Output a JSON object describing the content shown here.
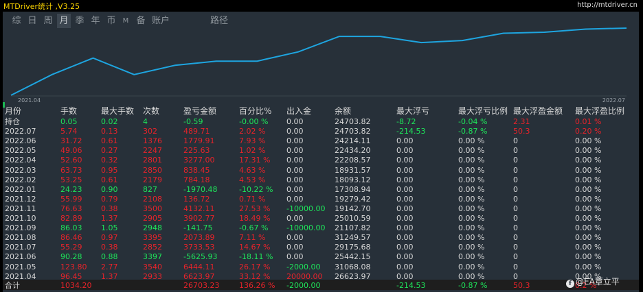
{
  "app": {
    "title": "MTDriver统计 ,V3.25",
    "url": "http://mtdriver.cn"
  },
  "tabs": [
    {
      "label": "综",
      "active": false
    },
    {
      "label": "日",
      "active": false
    },
    {
      "label": "周",
      "active": false
    },
    {
      "label": "月",
      "active": true
    },
    {
      "label": "季",
      "active": false
    },
    {
      "label": "年",
      "active": false
    },
    {
      "label": "币",
      "active": false
    },
    {
      "label": "M",
      "active": false
    },
    {
      "label": "备",
      "active": false
    },
    {
      "label": "账户",
      "active": false
    },
    {
      "label": "路径",
      "active": false
    }
  ],
  "chart_data": {
    "type": "line",
    "x_start_label": "2021.04",
    "x_end_label": "2022.07",
    "x": [
      "2021.04",
      "2021.05",
      "2021.06",
      "2021.07",
      "2021.08",
      "2021.09",
      "2021.10",
      "2021.11",
      "2021.12",
      "2022.01",
      "2022.02",
      "2022.03",
      "2022.04",
      "2022.05",
      "2022.06",
      "2022.07"
    ],
    "y": [
      19000,
      21000,
      22600,
      21000,
      21900,
      22300,
      22300,
      23200,
      24700,
      24700,
      24100,
      24300,
      25000,
      25100,
      25400,
      25500
    ],
    "line_color": "#1ea5e0"
  },
  "table": {
    "columns": [
      "月份",
      "手数",
      "最大手数",
      "次数",
      "盈亏金额",
      "百分比%",
      "出入金",
      "余额",
      "最大浮亏",
      "最大浮亏比例",
      "最大浮盈金额",
      "最大浮盈比例"
    ],
    "rows": [
      {
        "c": [
          "持仓",
          "0.05",
          "0.02",
          "4",
          "-0.59",
          "-0.00 %",
          "0.00",
          "24703.82",
          "-8.72",
          "-0.04 %",
          "2.31",
          "0.01 %"
        ],
        "k": "g"
      },
      {
        "c": [
          "2022.07",
          "5.74",
          "0.13",
          "302",
          "489.71",
          "2.02 %",
          "0.00",
          "24703.82",
          "-214.53",
          "-0.87 %",
          "50.3",
          "0.20 %"
        ],
        "k": "r"
      },
      {
        "c": [
          "2022.06",
          "31.72",
          "0.61",
          "1376",
          "1779.91",
          "7.93 %",
          "0.00",
          "24214.11",
          "0.00",
          "0.00 %",
          "0",
          "0.00 %"
        ],
        "k": "r"
      },
      {
        "c": [
          "2022.05",
          "49.06",
          "0.27",
          "2247",
          "225.63",
          "1.02 %",
          "0.00",
          "22434.20",
          "0.00",
          "0.00 %",
          "0",
          "0.00 %"
        ],
        "k": "r"
      },
      {
        "c": [
          "2022.04",
          "52.60",
          "0.32",
          "2801",
          "3277.00",
          "17.31 %",
          "0.00",
          "22208.57",
          "0.00",
          "0.00 %",
          "0",
          "0.00 %"
        ],
        "k": "r"
      },
      {
        "c": [
          "2022.03",
          "63.73",
          "0.95",
          "2850",
          "838.45",
          "4.63 %",
          "0.00",
          "18931.57",
          "0.00",
          "0.00 %",
          "0",
          "0.00 %"
        ],
        "k": "r"
      },
      {
        "c": [
          "2022.02",
          "53.25",
          "0.61",
          "2179",
          "784.18",
          "4.53 %",
          "0.00",
          "18093.12",
          "0.00",
          "0.00 %",
          "0",
          "0.00 %"
        ],
        "k": "r"
      },
      {
        "c": [
          "2022.01",
          "24.23",
          "0.90",
          "827",
          "-1970.48",
          "-10.22 %",
          "0.00",
          "17308.94",
          "0.00",
          "0.00 %",
          "0",
          "0.00 %"
        ],
        "k": "g"
      },
      {
        "c": [
          "2021.12",
          "55.99",
          "0.79",
          "2108",
          "136.72",
          "0.71 %",
          "0.00",
          "19279.42",
          "0.00",
          "0.00 %",
          "0",
          "0.00 %"
        ],
        "k": "r"
      },
      {
        "c": [
          "2021.11",
          "76.63",
          "0.38",
          "3500",
          "4132.11",
          "27.53 %",
          "-10000.00",
          "19142.70",
          "0.00",
          "0.00 %",
          "0",
          "0.00 %"
        ],
        "k": "r"
      },
      {
        "c": [
          "2021.10",
          "82.89",
          "1.37",
          "2905",
          "3902.77",
          "18.49 %",
          "0.00",
          "25010.59",
          "0.00",
          "0.00 %",
          "0",
          "0.00 %"
        ],
        "k": "r"
      },
      {
        "c": [
          "2021.09",
          "86.03",
          "1.05",
          "2948",
          "-141.75",
          "-0.67 %",
          "-10000.00",
          "21107.82",
          "0.00",
          "0.00 %",
          "0",
          "0.00 %"
        ],
        "k": "g"
      },
      {
        "c": [
          "2021.08",
          "86.46",
          "0.97",
          "3395",
          "2073.89",
          "7.11 %",
          "0.00",
          "31249.57",
          "0.00",
          "0.00 %",
          "0",
          "0.00 %"
        ],
        "k": "r"
      },
      {
        "c": [
          "2021.07",
          "55.29",
          "0.38",
          "2852",
          "3733.53",
          "14.67 %",
          "0.00",
          "29175.68",
          "0.00",
          "0.00 %",
          "0",
          "0.00 %"
        ],
        "k": "r"
      },
      {
        "c": [
          "2021.06",
          "90.28",
          "0.88",
          "3397",
          "-5625.93",
          "-18.11 %",
          "0.00",
          "25442.15",
          "0.00",
          "0.00 %",
          "0",
          "0.00 %"
        ],
        "k": "g"
      },
      {
        "c": [
          "2021.05",
          "123.80",
          "2.77",
          "3540",
          "6444.11",
          "26.17 %",
          "-2000.00",
          "31068.08",
          "0.00",
          "0.00 %",
          "0",
          "0.00 %"
        ],
        "k": "r"
      },
      {
        "c": [
          "2021.04",
          "96.45",
          "1.37",
          "2933",
          "6623.97",
          "33.12 %",
          "20000.00",
          "26623.97",
          "0.00",
          "0.00 %",
          "0",
          "0.00 %"
        ],
        "k": "r"
      }
    ],
    "total": {
      "c": [
        "合计",
        "1034.20",
        "",
        "",
        "26703.23",
        "136.26 %",
        "-2000.00",
        "",
        "-214.53",
        "-0.87 %",
        "50.3",
        "0.2 %"
      ],
      "k": "t"
    }
  },
  "colors": {
    "red": "#e8232a",
    "green": "#1ee55a",
    "white": "#d8d8d8",
    "panel": "#273039"
  },
  "watermark": {
    "icon": "facebook-icon",
    "text": "@EA覃立平"
  }
}
